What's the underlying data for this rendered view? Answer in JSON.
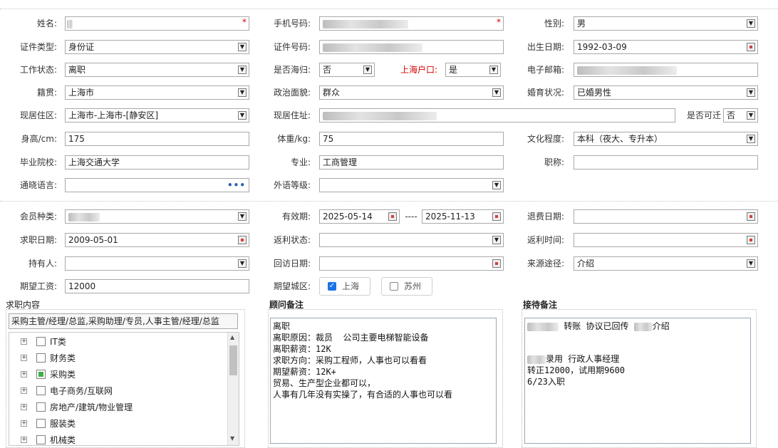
{
  "row1": {
    "name_label": "姓名:",
    "name_value": "",
    "required_mark": "*",
    "phone_label": "手机号码:",
    "phone_value": "",
    "gender_label": "性别:",
    "gender_value": "男"
  },
  "row2": {
    "idtype_label": "证件类型:",
    "idtype_value": "身份证",
    "idno_label": "证件号码:",
    "idno_value": "",
    "birth_label": "出生日期:",
    "birth_value": "1992-03-09"
  },
  "row3": {
    "workstatus_label": "工作状态:",
    "workstatus_value": "离职",
    "returnee_label": "是否海归:",
    "returnee_value": "否",
    "hukou_label": "上海户口:",
    "hukou_value": "是",
    "email_label": "电子邮箱:",
    "email_value": ""
  },
  "row4": {
    "native_label": "籍贯:",
    "native_value": "上海市",
    "political_label": "政治面貌:",
    "political_value": "群众",
    "marital_label": "婚育状况:",
    "marital_value": "已婚男性"
  },
  "row5": {
    "residence_label": "现居住区:",
    "residence_value": "上海市-上海市-[静安区]",
    "address_label": "现居住址:",
    "address_value": "",
    "relocate_label": "是否可迁",
    "relocate_value": "否"
  },
  "row6": {
    "height_label": "身高/cm:",
    "height_value": "175",
    "weight_label": "体重/kg:",
    "weight_value": "75",
    "edu_label": "文化程度:",
    "edu_value": "本科（夜大、专升本）"
  },
  "row7": {
    "school_label": "毕业院校:",
    "school_value": "上海交通大学",
    "major_label": "专业:",
    "major_value": "工商管理",
    "title_label": "职称:",
    "title_value": ""
  },
  "row8": {
    "lang_label": "通晓语言:",
    "lang_value": "",
    "lang_more": "•••",
    "foreign_label": "外语等级:",
    "foreign_value": ""
  },
  "row9": {
    "member_label": "会员种类:",
    "member_value": "",
    "valid_label": "有效期:",
    "valid_from": "2025-05-14",
    "valid_sep": "----",
    "valid_to": "2025-11-13",
    "refund_label": "退费日期:",
    "refund_value": ""
  },
  "row10": {
    "jobdate_label": "求职日期:",
    "jobdate_value": "2009-05-01",
    "rebate_status_label": "返利状态:",
    "rebate_status_value": "",
    "rebate_time_label": "返利时间:",
    "rebate_time_value": ""
  },
  "row11": {
    "holder_label": "持有人:",
    "holder_value": "",
    "visit_label": "回访日期:",
    "visit_value": "",
    "source_label": "来源途径:",
    "source_value": "介绍"
  },
  "row12": {
    "salary_label": "期望工资:",
    "salary_value": "12000",
    "city_label": "期望城区:",
    "cities": [
      {
        "label": "上海",
        "checked": true
      },
      {
        "label": "苏州",
        "checked": false
      }
    ]
  },
  "job_panel": {
    "title": "求职内容",
    "summary": "采购主管/经理/总监,采购助理/专员,人事主管/经理/总监",
    "items": [
      {
        "label": "IT类",
        "state": "none"
      },
      {
        "label": "财务类",
        "state": "none"
      },
      {
        "label": "采购类",
        "state": "partial"
      },
      {
        "label": "电子商务/互联网",
        "state": "none"
      },
      {
        "label": "房地产/建筑/物业管理",
        "state": "none"
      },
      {
        "label": "服装类",
        "state": "none"
      },
      {
        "label": "机械类",
        "state": "none"
      }
    ],
    "expander": "+"
  },
  "consultant_panel": {
    "title": "顾问备注",
    "text": "离职\n离职原因：裁员  公司主要电梯智能设备\n离职薪资：12K\n求职方向：采购工程师，人事也可以看看\n期望薪资：12K+\n贸易、生产型企业都可以，\n人事有几年没有实操了，有合适的人事也可以看"
  },
  "reception_panel": {
    "title": "接待备注",
    "line1_mid": "转账 协议已回传",
    "line1_end": "介绍",
    "line2_end": "录用 行政人事经理",
    "line3": "转正12000，试用期9600",
    "line4": "6/23入职"
  },
  "colors": {
    "hukou_label": "#d40000",
    "required": "#d40000",
    "checkbox_on": "#1a73e8",
    "tree_partial": "#3bb04a"
  }
}
